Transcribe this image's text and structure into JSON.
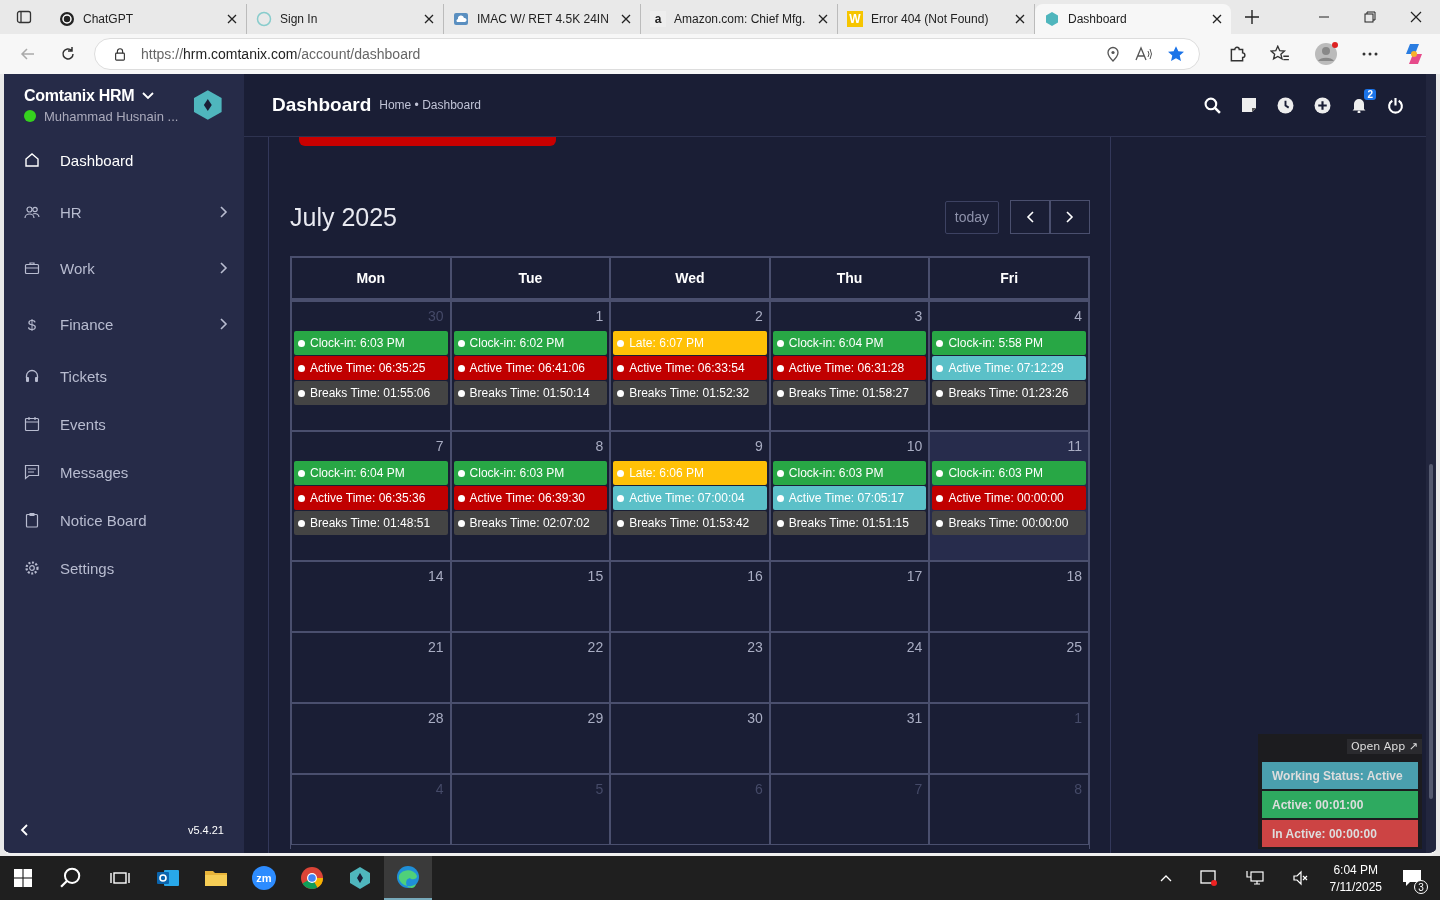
{
  "browser": {
    "tabs": [
      {
        "title": "ChatGPT",
        "selected": false
      },
      {
        "title": "Sign In",
        "selected": false
      },
      {
        "title": "IMAC W/ RET 4.5K 24IN",
        "selected": false
      },
      {
        "title": "Amazon.com: Chief Mfg.",
        "favicon_text": "a",
        "selected": false
      },
      {
        "title": "Error 404 (Not Found)",
        "favicon_text": "W",
        "selected": false
      },
      {
        "title": "Dashboard",
        "selected": true
      }
    ],
    "url_prefix": "https://",
    "url_host": "hrm.comtanix.com",
    "url_path": "/account/dashboard"
  },
  "sidebar": {
    "brand": "Comtanix HRM",
    "user": "Muhammad Husnain ...",
    "online": true,
    "items": [
      {
        "label": "Dashboard",
        "submenu": false,
        "selected": true
      },
      {
        "label": "HR",
        "submenu": true,
        "selected": false
      },
      {
        "label": "Work",
        "submenu": true,
        "selected": false
      },
      {
        "label": "Finance",
        "glyph": "$",
        "submenu": true,
        "selected": false
      },
      {
        "label": "Tickets",
        "submenu": false,
        "selected": false
      },
      {
        "label": "Events",
        "submenu": false,
        "selected": false
      },
      {
        "label": "Messages",
        "submenu": false,
        "selected": false
      },
      {
        "label": "Notice Board",
        "submenu": false,
        "selected": false
      },
      {
        "label": "Settings",
        "submenu": false,
        "selected": false
      }
    ],
    "version": "v5.4.21"
  },
  "header": {
    "title": "Dashboard",
    "breadcrumb": "Home • Dashboard",
    "notifications": "2"
  },
  "calendar": {
    "title": "July 2025",
    "today_button": "today",
    "columns": [
      "Mon",
      "Tue",
      "Wed",
      "Thu",
      "Fri"
    ],
    "weeks": [
      {
        "days": [
          {
            "day": "30",
            "other_month": true,
            "today": false,
            "events": [
              {
                "text": "Clock-in: 6:03 PM",
                "color": "#28a745"
              },
              {
                "text": "Active Time: 06:35:25",
                "color": "#c00000"
              },
              {
                "text": "Breaks Time: 01:55:06",
                "color": "#444444"
              }
            ]
          },
          {
            "day": "1",
            "other_month": false,
            "today": false,
            "events": [
              {
                "text": "Clock-in: 6:02 PM",
                "color": "#28a745"
              },
              {
                "text": "Active Time: 06:41:06",
                "color": "#c00000"
              },
              {
                "text": "Breaks Time: 01:50:14",
                "color": "#444444"
              }
            ]
          },
          {
            "day": "2",
            "other_month": false,
            "today": false,
            "events": [
              {
                "text": "Late: 6:07 PM",
                "color": "#ffc107"
              },
              {
                "text": "Active Time: 06:33:54",
                "color": "#c00000"
              },
              {
                "text": "Breaks Time: 01:52:32",
                "color": "#444444"
              }
            ]
          },
          {
            "day": "3",
            "other_month": false,
            "today": false,
            "events": [
              {
                "text": "Clock-in: 6:04 PM",
                "color": "#28a745"
              },
              {
                "text": "Active Time: 06:31:28",
                "color": "#c00000"
              },
              {
                "text": "Breaks Time: 01:58:27",
                "color": "#444444"
              }
            ]
          },
          {
            "day": "4",
            "other_month": false,
            "today": false,
            "events": [
              {
                "text": "Clock-in: 5:58 PM",
                "color": "#28a745"
              },
              {
                "text": "Active Time: 07:12:29",
                "color": "#5bc0c8"
              },
              {
                "text": "Breaks Time: 01:23:26",
                "color": "#444444"
              }
            ]
          }
        ]
      },
      {
        "days": [
          {
            "day": "7",
            "other_month": false,
            "today": false,
            "events": [
              {
                "text": "Clock-in: 6:04 PM",
                "color": "#28a745"
              },
              {
                "text": "Active Time: 06:35:36",
                "color": "#c00000"
              },
              {
                "text": "Breaks Time: 01:48:51",
                "color": "#444444"
              }
            ]
          },
          {
            "day": "8",
            "other_month": false,
            "today": false,
            "events": [
              {
                "text": "Clock-in: 6:03 PM",
                "color": "#28a745"
              },
              {
                "text": "Active Time: 06:39:30",
                "color": "#c00000"
              },
              {
                "text": "Breaks Time: 02:07:02",
                "color": "#444444"
              }
            ]
          },
          {
            "day": "9",
            "other_month": false,
            "today": false,
            "events": [
              {
                "text": "Late: 6:06 PM",
                "color": "#ffc107"
              },
              {
                "text": "Active Time: 07:00:04",
                "color": "#5bc0c8"
              },
              {
                "text": "Breaks Time: 01:53:42",
                "color": "#444444"
              }
            ]
          },
          {
            "day": "10",
            "other_month": false,
            "today": false,
            "events": [
              {
                "text": "Clock-in: 6:03 PM",
                "color": "#28a745"
              },
              {
                "text": "Active Time: 07:05:17",
                "color": "#5bc0c8"
              },
              {
                "text": "Breaks Time: 01:51:15",
                "color": "#444444"
              }
            ]
          },
          {
            "day": "11",
            "other_month": false,
            "today": true,
            "events": [
              {
                "text": "Clock-in: 6:03 PM",
                "color": "#28a745"
              },
              {
                "text": "Active Time: 00:00:00",
                "color": "#c00000"
              },
              {
                "text": "Breaks Time: 00:00:00",
                "color": "#444444"
              }
            ]
          }
        ]
      },
      {
        "days": [
          {
            "day": "14",
            "other_month": false,
            "today": false
          },
          {
            "day": "15",
            "other_month": false,
            "today": false
          },
          {
            "day": "16",
            "other_month": false,
            "today": false
          },
          {
            "day": "17",
            "other_month": false,
            "today": false
          },
          {
            "day": "18",
            "other_month": false,
            "today": false
          }
        ]
      },
      {
        "days": [
          {
            "day": "21",
            "other_month": false,
            "today": false
          },
          {
            "day": "22",
            "other_month": false,
            "today": false
          },
          {
            "day": "23",
            "other_month": false,
            "today": false
          },
          {
            "day": "24",
            "other_month": false,
            "today": false
          },
          {
            "day": "25",
            "other_month": false,
            "today": false
          }
        ]
      },
      {
        "days": [
          {
            "day": "28",
            "other_month": false,
            "today": false
          },
          {
            "day": "29",
            "other_month": false,
            "today": false
          },
          {
            "day": "30",
            "other_month": false,
            "today": false
          },
          {
            "day": "31",
            "other_month": false,
            "today": false
          },
          {
            "day": "1",
            "other_month": true,
            "today": false
          }
        ]
      },
      {
        "days": [
          {
            "day": "4",
            "other_month": true,
            "today": false
          },
          {
            "day": "5",
            "other_month": true,
            "today": false
          },
          {
            "day": "6",
            "other_month": true,
            "today": false
          },
          {
            "day": "7",
            "other_month": true,
            "today": false
          },
          {
            "day": "8",
            "other_month": true,
            "today": false
          }
        ]
      }
    ]
  },
  "status_widget": {
    "open_app": "Open App ↗",
    "rows": [
      {
        "text": "Working Status: Active",
        "color": "#4a9fae"
      },
      {
        "text": "Active: 00:01:00",
        "color": "#2eaa60"
      },
      {
        "text": "In Active: 00:00:00",
        "color": "#cc4444"
      }
    ]
  },
  "taskbar": {
    "apps": [
      {
        "selected": false
      },
      {
        "selected": false
      },
      {
        "selected": false
      },
      {
        "selected": false
      },
      {
        "selected": false
      },
      {
        "selected": true
      }
    ],
    "zoom_glyph": "zm",
    "time": "6:04 PM",
    "date": "7/11/2025",
    "notifications": "3"
  }
}
